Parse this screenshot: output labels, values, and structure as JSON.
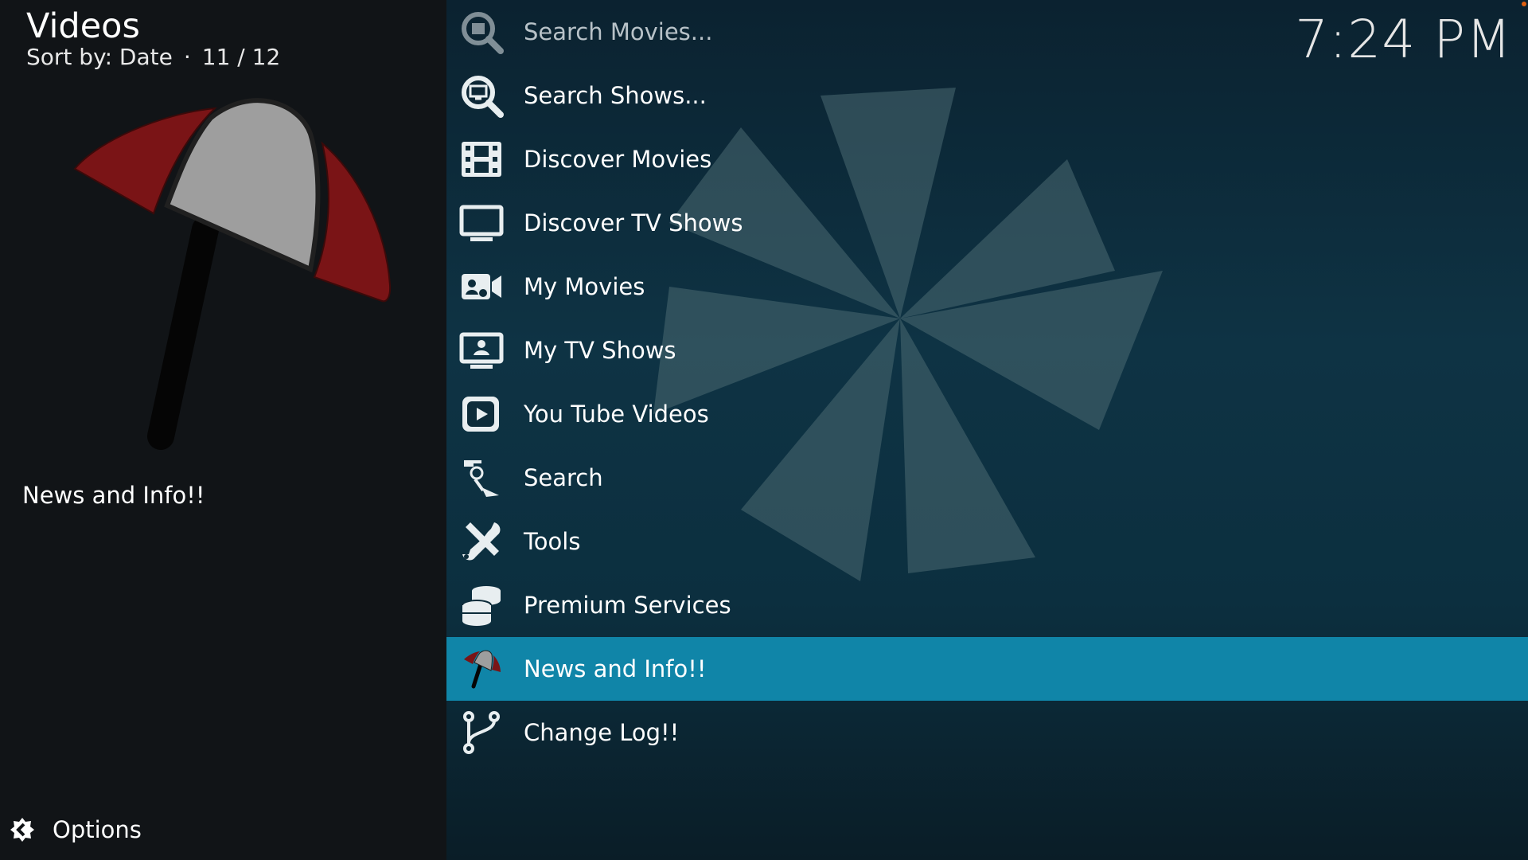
{
  "header": {
    "title": "Videos",
    "sort_label": "Sort by: Date",
    "separator": "·",
    "position": "11 / 12"
  },
  "clock": "7:24 PM",
  "selected_item": {
    "description": "News and Info!!",
    "thumbnail_icon": "umbrella-icon"
  },
  "options": {
    "label": "Options",
    "icon": "options-icon"
  },
  "menu": {
    "focused_index": 10,
    "items": [
      {
        "label": "Search Movies...",
        "icon": "search-movies-icon"
      },
      {
        "label": "Search Shows...",
        "icon": "search-shows-icon"
      },
      {
        "label": "Discover Movies",
        "icon": "film-icon"
      },
      {
        "label": "Discover TV Shows",
        "icon": "tv-icon"
      },
      {
        "label": "My Movies",
        "icon": "video-camera-icon"
      },
      {
        "label": "My TV Shows",
        "icon": "tv-person-icon"
      },
      {
        "label": "You Tube Videos",
        "icon": "play-icon"
      },
      {
        "label": "Search",
        "icon": "search-tools-icon"
      },
      {
        "label": "Tools",
        "icon": "tools-icon"
      },
      {
        "label": "Premium Services",
        "icon": "coins-icon"
      },
      {
        "label": "News and Info!!",
        "icon": "umbrella-icon"
      },
      {
        "label": "Change Log!!",
        "icon": "branch-icon"
      }
    ]
  },
  "colors": {
    "focus": "#1085a8",
    "umbrella_red": "#7a1416",
    "umbrella_grey": "#9e9e9e",
    "text": "#ffffff"
  }
}
